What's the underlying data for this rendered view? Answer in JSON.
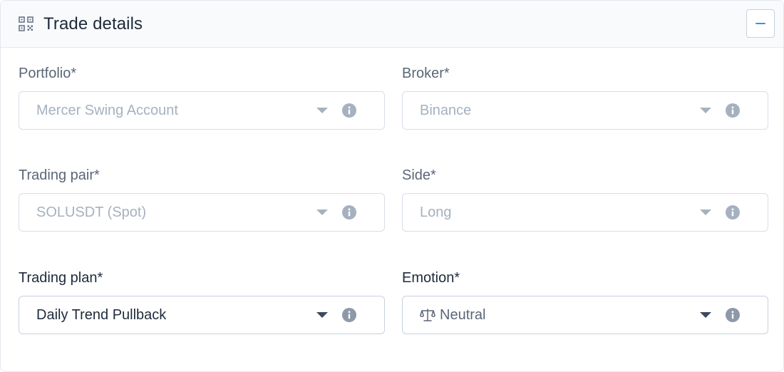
{
  "header": {
    "title": "Trade details",
    "icon": "qr-code-icon",
    "collapse_icon": "minus-icon"
  },
  "fields": {
    "portfolio": {
      "label": "Portfolio*",
      "value": "Mercer Swing Account"
    },
    "broker": {
      "label": "Broker*",
      "value": "Binance"
    },
    "trading_pair": {
      "label": "Trading pair*",
      "value": "SOLUSDT (Spot)"
    },
    "side": {
      "label": "Side*",
      "value": "Long"
    },
    "trading_plan": {
      "label": "Trading plan*",
      "value": "Daily Trend Pullback"
    },
    "emotion": {
      "label": "Emotion*",
      "value": "Neutral",
      "icon": "scale-icon"
    }
  },
  "colors": {
    "accent": "#2f95e8",
    "text_dark": "#1e2a3b",
    "text_muted": "#5b6677",
    "text_disabled": "#a6b1c0"
  }
}
